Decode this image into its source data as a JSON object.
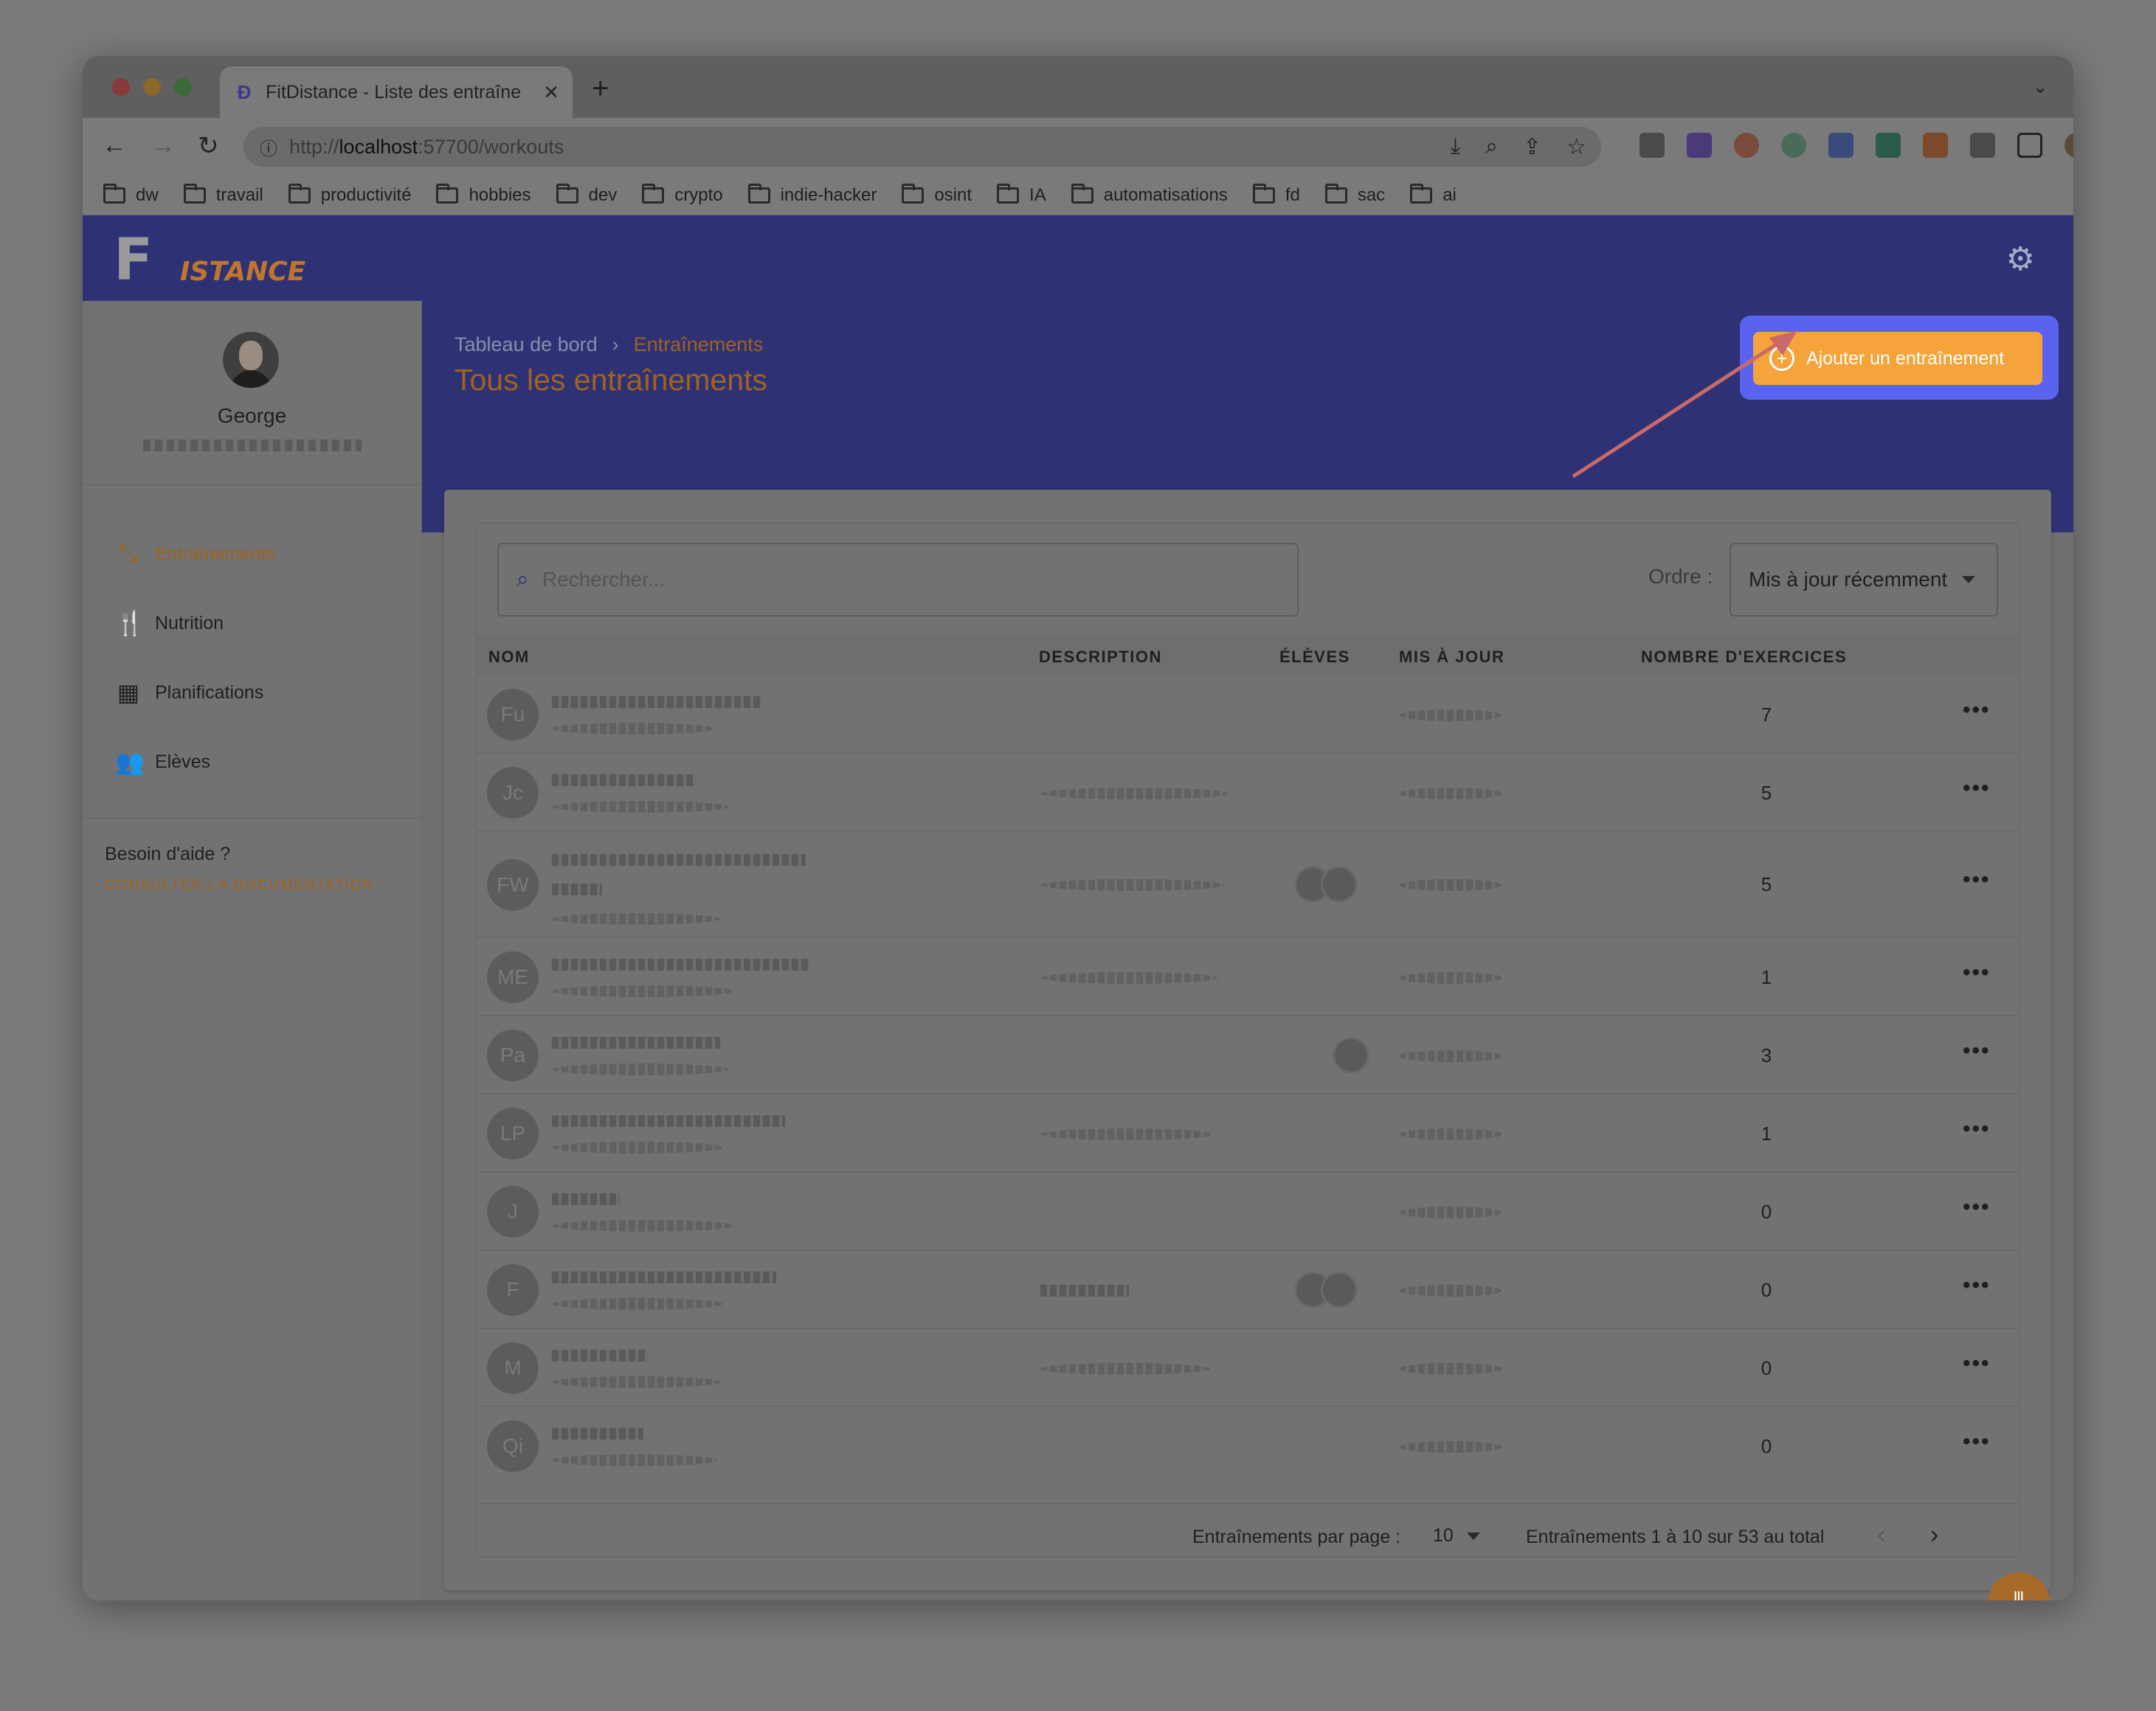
{
  "browser": {
    "tab_title": "FitDistance - Liste des entraîne",
    "url_prefix": "http://",
    "url_host": "localhost",
    "url_rest": ":57700/workouts",
    "bookmarks": [
      "dw",
      "travail",
      "productivité",
      "hobbies",
      "dev",
      "crypto",
      "indie-hacker",
      "osint",
      "IA",
      "automatisations",
      "fd",
      "sac",
      "ai"
    ]
  },
  "app": {
    "logo_letter": "F",
    "logo_text": "ISTANCE"
  },
  "sidebar": {
    "user_name": "George",
    "nav": [
      {
        "label": "Entraînements",
        "icon": "dumbbell-icon",
        "active": true
      },
      {
        "label": "Nutrition",
        "icon": "utensils-icon",
        "active": false
      },
      {
        "label": "Planifications",
        "icon": "calendar-icon",
        "active": false
      },
      {
        "label": "Elèves",
        "icon": "users-icon",
        "active": false
      }
    ],
    "help_title": "Besoin d'aide ?",
    "help_link": "CONSULTER LA DOCUMENTATION"
  },
  "header": {
    "breadcrumb_root": "Tableau de bord",
    "breadcrumb_current": "Entraînements",
    "title": "Tous les entraînements",
    "add_button": "Ajouter un entraînement"
  },
  "toolbar": {
    "search_placeholder": "Rechercher...",
    "order_label": "Ordre :",
    "order_value": "Mis à jour récemment"
  },
  "table": {
    "columns": [
      "NOM",
      "DESCRIPTION",
      "ÉLÈVES",
      "MIS À JOUR",
      "NOMBRE D'EXERCICES"
    ],
    "rows": [
      {
        "initials": "Fu",
        "exercises": "7"
      },
      {
        "initials": "Jc",
        "exercises": "5"
      },
      {
        "initials": "FW",
        "exercises": "5"
      },
      {
        "initials": "ME",
        "exercises": "1"
      },
      {
        "initials": "Pa",
        "exercises": "3"
      },
      {
        "initials": "LP",
        "exercises": "1"
      },
      {
        "initials": "J",
        "exercises": "0"
      },
      {
        "initials": "F",
        "exercises": "0"
      },
      {
        "initials": "M",
        "exercises": "0"
      },
      {
        "initials": "Qi",
        "exercises": "0"
      }
    ]
  },
  "pagination": {
    "per_page_label": "Entraînements par page :",
    "per_page": "10",
    "range": "Entraînements 1 à 10 sur 53 au total"
  },
  "colors": {
    "brand_blue": "#2e3274",
    "accent_orange": "#f4a43a",
    "highlight": "#5a63f0"
  }
}
